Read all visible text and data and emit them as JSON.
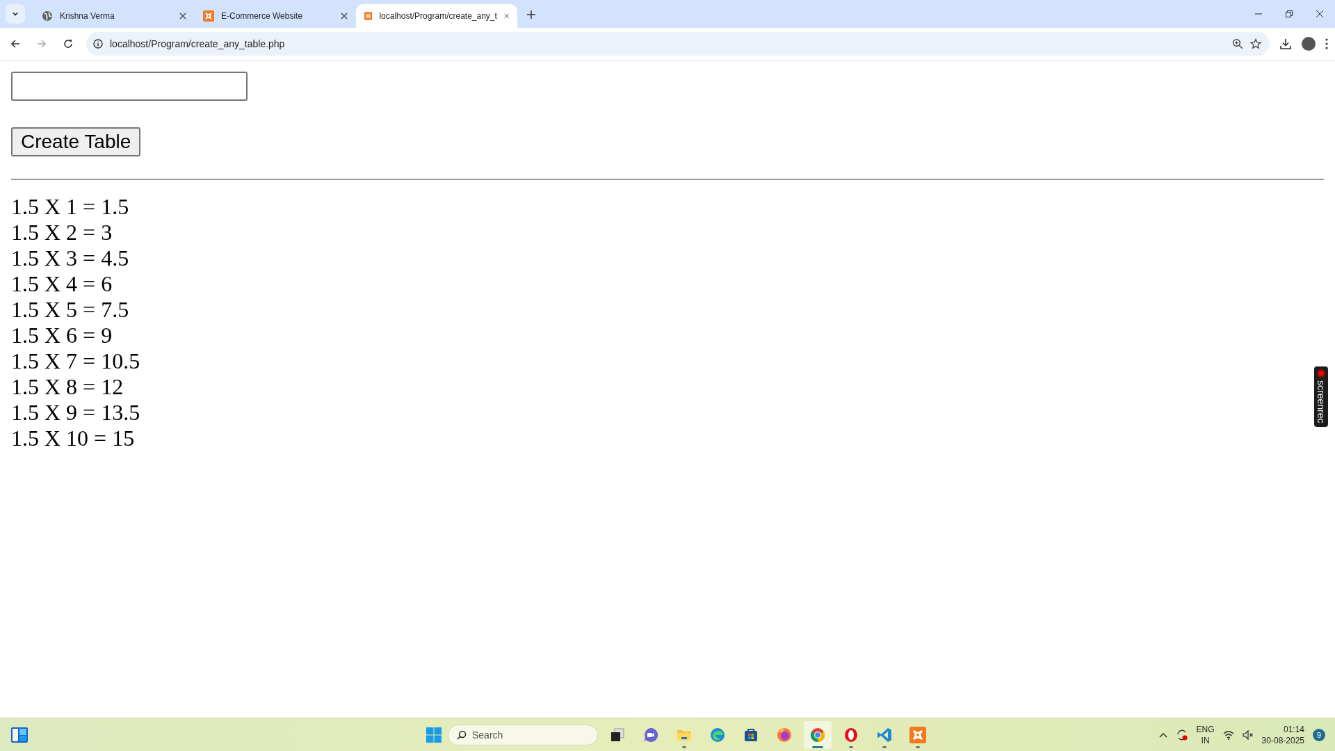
{
  "browser": {
    "tabs": [
      {
        "title": "Krishna Verma",
        "selected": false
      },
      {
        "title": "E-Commerce Website",
        "selected": false
      },
      {
        "title": "localhost/Program/create_any_t",
        "selected": true
      }
    ],
    "address": "localhost/Program/create_any_table.php"
  },
  "page": {
    "button": "Create Table",
    "lines": [
      "1.5 X 1 = 1.5",
      "1.5 X 2 = 3",
      "1.5 X 3 = 4.5",
      "1.5 X 4 = 6",
      "1.5 X 5 = 7.5",
      "1.5 X 6 = 9",
      "1.5 X 7 = 10.5",
      "1.5 X 8 = 12",
      "1.5 X 9 = 13.5",
      "1.5 X 10 = 15"
    ]
  },
  "recorder": {
    "label": "screenrec"
  },
  "taskbar": {
    "search": "Search",
    "apps": [
      {
        "kind": "taskview",
        "running": false,
        "selected": false
      },
      {
        "kind": "chat",
        "running": false,
        "selected": false
      },
      {
        "kind": "explorer",
        "running": true,
        "selected": false
      },
      {
        "kind": "edge",
        "running": false,
        "selected": false
      },
      {
        "kind": "store",
        "running": false,
        "selected": false
      },
      {
        "kind": "firefox",
        "running": false,
        "selected": false
      },
      {
        "kind": "chrome",
        "running": true,
        "selected": true
      },
      {
        "kind": "opera",
        "running": true,
        "selected": false
      },
      {
        "kind": "vscode",
        "running": true,
        "selected": false
      },
      {
        "kind": "xampp",
        "running": true,
        "selected": false
      }
    ],
    "language": "ENG",
    "region": "IN",
    "time": "01:14",
    "date": "30-08-2025",
    "notifications": "9"
  }
}
